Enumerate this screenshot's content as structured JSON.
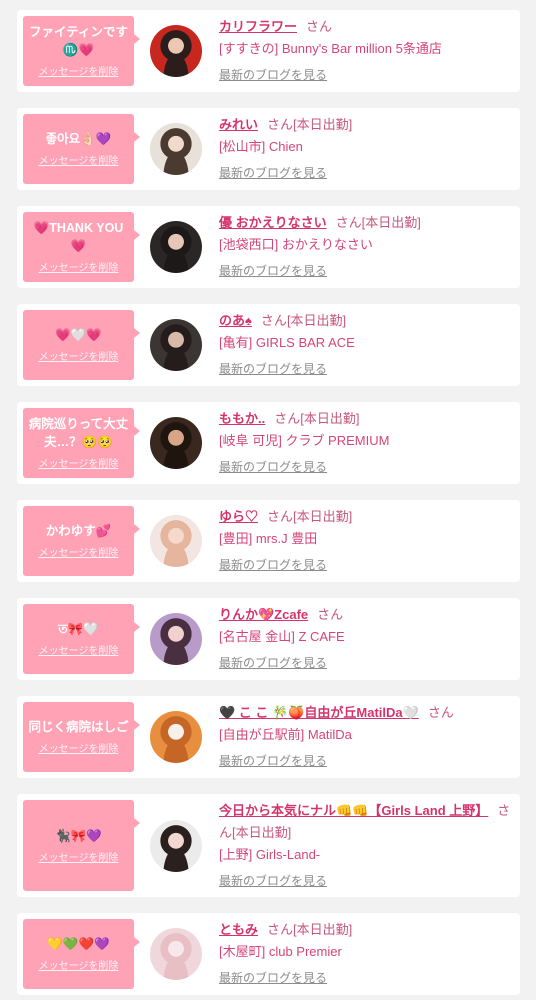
{
  "labels": {
    "honorific": "さん",
    "delete_message": "メッセージを削除",
    "latest_blog": "最新のブログを見る"
  },
  "colors": {
    "page_bg": "#f2f2f2",
    "card_bg": "#ffffff",
    "bubble": "#ffa2b6",
    "name": "#d6336c",
    "sub": "#c7587c",
    "shop": "#d6457a",
    "link_gray": "#8c8c8c"
  },
  "messages": [
    {
      "bubble_text": "ファイティンです♏💗",
      "name": "カリフラワー",
      "shop": "[すすきの] Bunny's Bar million 5条通店",
      "avatar_colors": [
        "#c8271f",
        "#2b1d1b",
        "#ecc7b2"
      ]
    },
    {
      "bubble_text": "좋아요👌🏻💜",
      "name": "みれい",
      "status": "[本日出勤]",
      "shop": "[松山市] Chien",
      "avatar_colors": [
        "#e7e1d9",
        "#4b3a30",
        "#f1dacb"
      ]
    },
    {
      "bubble_text": "💗THANK YOU💗",
      "name": "優 おかえりなさい",
      "status": "[本日出勤]",
      "shop": "[池袋西口] おかえりなさい",
      "avatar_colors": [
        "#2b2727",
        "#1d1919",
        "#e6c6b6"
      ]
    },
    {
      "bubble_text": "💗🤍💗",
      "name": "のあ♠",
      "status": "[本日出勤]",
      "shop": "[亀有] GIRLS BAR ACE",
      "avatar_colors": [
        "#3b3533",
        "#241d1b",
        "#d9b9a9"
      ]
    },
    {
      "bubble_text": "病院巡りって大丈夫…？🥺🥺",
      "name": "ももか..",
      "status": "[本日出勤]",
      "shop": "[岐阜 可児] クラブ PREMIUM",
      "avatar_colors": [
        "#3a281f",
        "#1f150f",
        "#d6a686"
      ]
    },
    {
      "bubble_text": "かわゆす💕",
      "name": "ゆら♡",
      "status": "[本日出勤]",
      "shop": "[豊田] mrs.J 豊田",
      "avatar_colors": [
        "#f3e6e2",
        "#e6b59e",
        "#f5d9cd"
      ]
    },
    {
      "bubble_text": "ত🎀🤍",
      "name": "りんか💖Zcafe",
      "shop": "[名古屋 金山] Z CAFE",
      "avatar_colors": [
        "#b99bc9",
        "#4a2f41",
        "#f1d1cd"
      ]
    },
    {
      "bubble_text": "同じく病院はしご",
      "name": "🖤 こ こ 🎋🍑自由が丘MatilDa🤍",
      "shop": "[自由が丘駅前] MatilDa",
      "avatar_colors": [
        "#e78f3f",
        "#c56626",
        "#f8f1e9"
      ]
    },
    {
      "bubble_text": "🐈‍⬛🎀💜",
      "name": "今日から本気にナル👊👊【Girls Land 上野】",
      "status": "[本日出勤]",
      "shop": "[上野] Girls-Land-",
      "avatar_colors": [
        "#ecebeb",
        "#2a211f",
        "#f1d9d1"
      ]
    },
    {
      "bubble_text": "💛💚❤️💜",
      "name": "ともみ",
      "status": "[本日出勤]",
      "shop": "[木屋町] club Premier",
      "avatar_colors": [
        "#f0d7db",
        "#e7bfc4",
        "#f8e8ea"
      ]
    }
  ]
}
